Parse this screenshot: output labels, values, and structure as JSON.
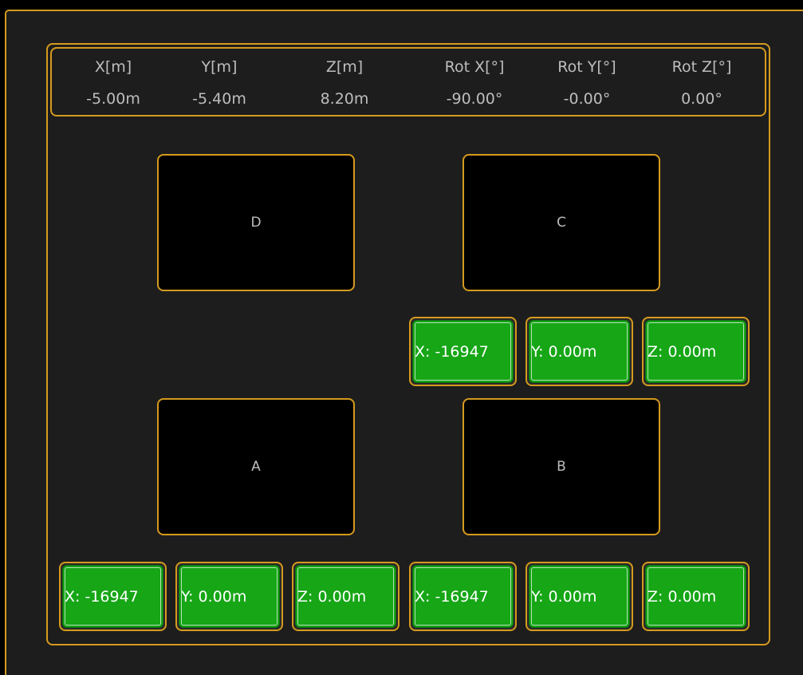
{
  "header": {
    "columns": [
      {
        "label": "X[m]",
        "value": "-5.00m"
      },
      {
        "label": "Y[m]",
        "value": "-5.40m"
      },
      {
        "label": "Z[m]",
        "value": "8.20m"
      },
      {
        "label": "Rot X[°]",
        "value": "-90.00°"
      },
      {
        "label": "Rot Y[°]",
        "value": "-0.00°"
      },
      {
        "label": "Rot Z[°]",
        "value": "0.00°"
      }
    ]
  },
  "boxes": {
    "d": "D",
    "c": "C",
    "a": "A",
    "b": "B"
  },
  "buttons": {
    "c_x": "X: -16947",
    "c_y": "Y: 0.00m",
    "c_z": "Z: 0.00m",
    "a_x": "X: -16947",
    "a_y": "Y: 0.00m",
    "a_z": "Z: 0.00m",
    "b_x": "X: -16947",
    "b_y": "Y: 0.00m",
    "b_z": "Z: 0.00m"
  },
  "colors": {
    "accent": "#d59a1e",
    "button_green": "#16a616",
    "background": "#1d1d1d"
  }
}
